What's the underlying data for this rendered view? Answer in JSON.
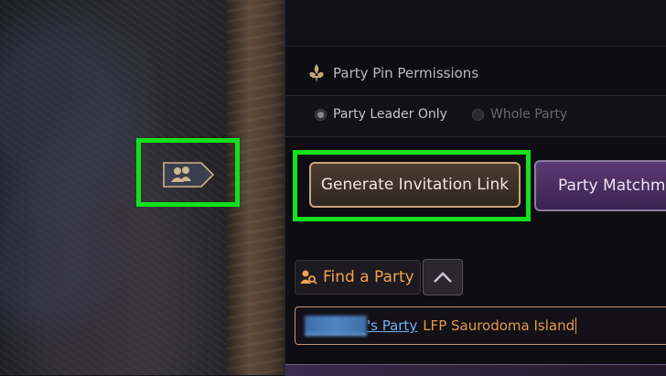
{
  "colors": {
    "highlight": "#12e11c",
    "gold_border": "#c7a678",
    "matchmaking_purple": "#5a3a73",
    "find_party_orange": "#f0a14b",
    "link_blue": "#6fb2f0"
  },
  "map_badge": {
    "icon": "party-members-icon"
  },
  "permissions": {
    "title": "Party Pin Permissions",
    "icon": "fleur-de-lis-icon",
    "options": [
      {
        "label": "Party Leader Only",
        "selected": true
      },
      {
        "label": "Whole Party",
        "selected": false
      }
    ]
  },
  "buttons": {
    "generate_invitation": "Generate Invitation Link",
    "party_matchmaking": "Party Matchmaking"
  },
  "find_party": {
    "label": "Find a Party",
    "icon": "find-party-icon",
    "collapse_icon": "chevron-up-icon"
  },
  "party_title_input": {
    "owner_suffix": "'s Party",
    "text": "LFP Saurodoma Island"
  }
}
